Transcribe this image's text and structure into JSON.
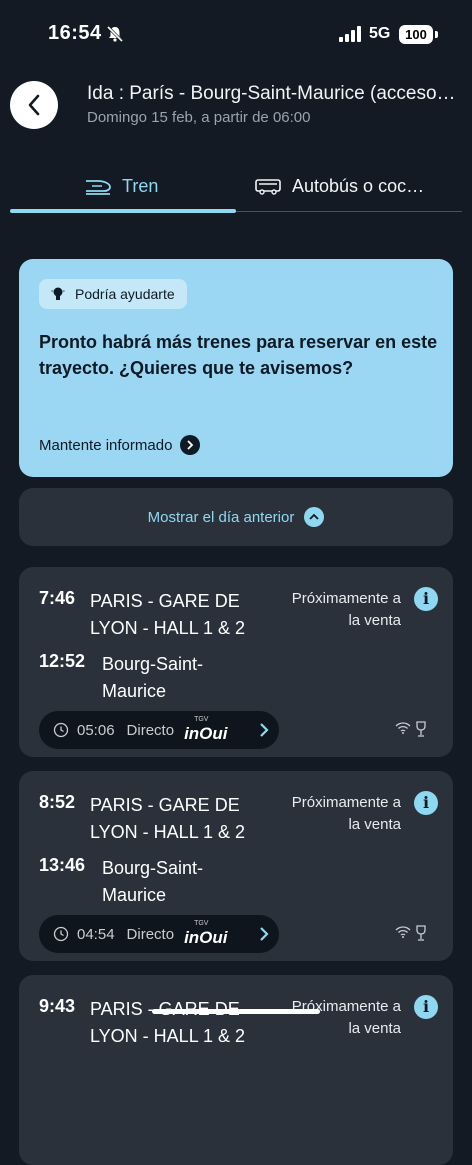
{
  "status_bar": {
    "time": "16:54",
    "network": "5G",
    "battery": "100"
  },
  "header": {
    "title": "Ida : París - Bourg-Saint-Maurice (acceso a pistas)",
    "subtitle": "Domingo 15 feb, a partir de 06:00"
  },
  "tabs": [
    {
      "label": "Tren",
      "icon": "train-icon",
      "active": true
    },
    {
      "label": "Autobús o coc…",
      "icon": "bus-icon",
      "active": false
    }
  ],
  "promo": {
    "chip": "Podría ayudarte",
    "message": "Pronto habrá más trenes para reservar en este trayecto. ¿Quieres que te avisemos?",
    "link": "Mantente informado"
  },
  "show_previous_day": "Mostrar el día anterior",
  "journeys": [
    {
      "depart_time": "7:46",
      "depart_station": "PARIS - GARE DE LYON - HALL 1 & 2",
      "arrive_time": "12:52",
      "arrive_station": "Bourg-Saint-Maurice",
      "sale_status": "Próximamente a la venta",
      "duration": "05:06",
      "type": "Directo",
      "brand_top": "TGV",
      "brand": "inOui"
    },
    {
      "depart_time": "8:52",
      "depart_station": "PARIS - GARE DE LYON - HALL 1 & 2",
      "arrive_time": "13:46",
      "arrive_station": "Bourg-Saint-Maurice",
      "sale_status": "Próximamente a la venta",
      "duration": "04:54",
      "type": "Directo",
      "brand_top": "TGV",
      "brand": "inOui"
    },
    {
      "depart_time": "9:43",
      "depart_station": "PARIS - GARE DE LYON - HALL 1 & 2",
      "sale_status": "Próximamente a la venta"
    }
  ],
  "colors": {
    "background": "#131a23",
    "accent": "#8fd8f2",
    "card": "#2a313b",
    "promo": "#9bd6f2"
  }
}
